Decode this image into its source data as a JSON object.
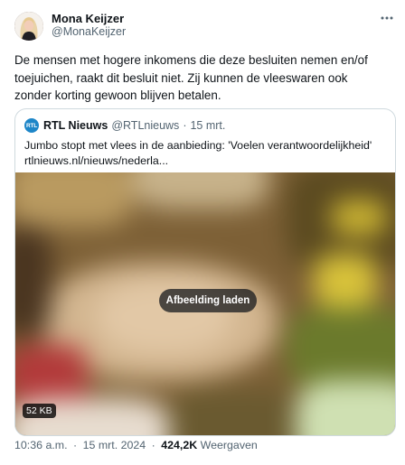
{
  "author": {
    "display_name": "Mona Keijzer",
    "handle": "@MonaKeijzer",
    "avatar_icon": "user-avatar"
  },
  "tweet": {
    "text": "De mensen met hogere inkomens die deze besluiten nemen en/of toejuichen, raakt dit besluit niet. Zij kunnen de vleeswaren ook zonder korting gewoon blijven betalen.",
    "more_icon": "more-dots-icon",
    "time": "10:36 a.m.",
    "date": "15 mrt. 2024",
    "separator": "·",
    "views_count": "424,2K",
    "views_label": "Weergaven"
  },
  "quote": {
    "logo_text": "RTL",
    "display_name": "RTL Nieuws",
    "handle": "@RTLnieuws",
    "separator": "·",
    "date": "15 mrt.",
    "headline": "Jumbo stopt met vlees in de aanbieding: 'Voelen verantwoordelijkheid'",
    "link": "rtlnieuws.nl/nieuws/nederla...",
    "media": {
      "load_label": "Afbeelding laden",
      "size_badge": "52 KB"
    }
  },
  "colors": {
    "text": "#0f1419",
    "secondary": "#536471",
    "border": "#cfd9de",
    "rtl_blue": "#1d86c8"
  }
}
